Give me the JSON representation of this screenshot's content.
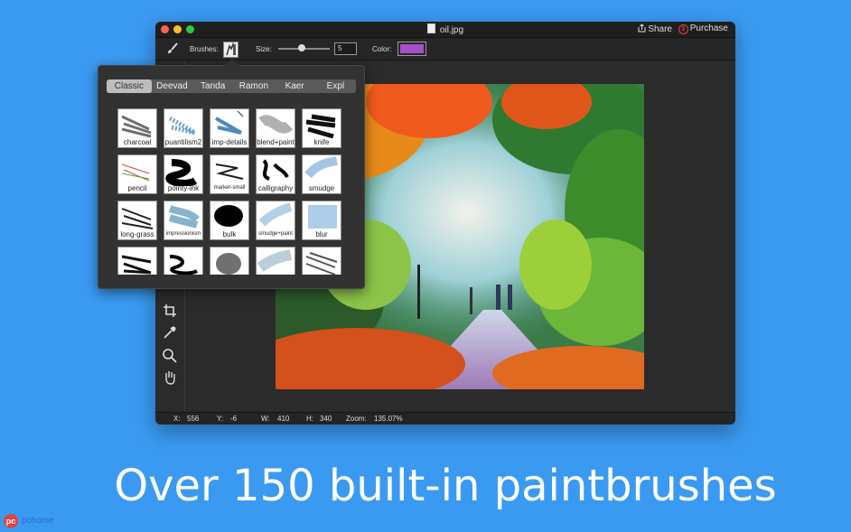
{
  "window": {
    "title": "oil.jpg",
    "share_label": "Share",
    "purchase_label": "Purchase",
    "purchase_icon": "$"
  },
  "toolbar": {
    "brushes_label": "Brushes:",
    "size_label": "Size:",
    "size_value": "5",
    "size_slider_level": 0.45,
    "color_label": "Color:",
    "color_value": "#a64fc9"
  },
  "brush_popover": {
    "tabs": [
      "Classic",
      "Deevad",
      "Tanda",
      "Ramon",
      "Kaer",
      "Expl"
    ],
    "selected_tab": "Classic",
    "brushes": [
      {
        "label": "charcoal",
        "icon": "charcoal-stroke"
      },
      {
        "label": "puantilism2",
        "icon": "puantilism-stroke"
      },
      {
        "label": "imp-details",
        "icon": "imp-details-stroke"
      },
      {
        "label": "blend+paint",
        "icon": "blend-paint-stroke"
      },
      {
        "label": "knife",
        "icon": "knife-stroke"
      },
      {
        "label": "pencil",
        "icon": "pencil-stroke"
      },
      {
        "label": "pointy-ink",
        "icon": "pointy-ink-stroke"
      },
      {
        "label": "marker-small",
        "icon": "marker-small-stroke"
      },
      {
        "label": "calligraphy",
        "icon": "calligraphy-stroke"
      },
      {
        "label": "smudge",
        "icon": "smudge-stroke"
      },
      {
        "label": "long-grass",
        "icon": "long-grass-stroke"
      },
      {
        "label": "impressionism",
        "icon": "impressionism-stroke"
      },
      {
        "label": "bulk",
        "icon": "bulk-stroke"
      },
      {
        "label": "smudge+paint",
        "icon": "smudge-paint-stroke"
      },
      {
        "label": "blur",
        "icon": "blur-stroke"
      },
      {
        "label": "",
        "icon": "grass-dark-stroke"
      },
      {
        "label": "",
        "icon": "scribble-stroke"
      },
      {
        "label": "",
        "icon": "soft-dark-stroke"
      },
      {
        "label": "",
        "icon": "light-smudge-stroke"
      },
      {
        "label": "",
        "icon": "hatch-stroke"
      }
    ]
  },
  "tools": [
    "brush-icon",
    "crop-icon",
    "eyedropper-icon",
    "zoom-icon",
    "hand-icon"
  ],
  "status": {
    "x_label": "X:",
    "x_value": "556",
    "y_label": "Y:",
    "y_value": "-6",
    "w_label": "W:",
    "w_value": "410",
    "h_label": "H:",
    "h_value": "340",
    "zoom_label": "Zoom:",
    "zoom_value": "135.07%"
  },
  "caption": "Over 150 built-in paintbrushes",
  "watermark": {
    "logo": "pc",
    "text": "pchome"
  }
}
